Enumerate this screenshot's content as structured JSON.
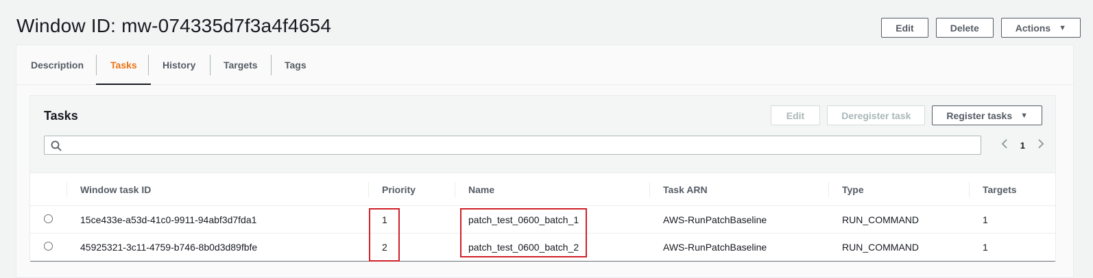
{
  "page": {
    "title": "Window ID: mw-074335d7f3a4f4654",
    "actions": {
      "edit": "Edit",
      "delete": "Delete",
      "actions": "Actions"
    }
  },
  "tabs": [
    "Description",
    "Tasks",
    "History",
    "Targets",
    "Tags"
  ],
  "active_tab": "Tasks",
  "tasks": {
    "title": "Tasks",
    "buttons": {
      "edit": "Edit",
      "deregister": "Deregister task",
      "register": "Register tasks"
    },
    "search": {
      "value": "",
      "placeholder": ""
    },
    "pager": {
      "page": "1"
    },
    "columns": [
      "Window task ID",
      "Priority",
      "Name",
      "Task ARN",
      "Type",
      "Targets"
    ],
    "rows": [
      {
        "id": "15ce433e-a53d-41c0-9911-94abf3d7fda1",
        "priority": "1",
        "name": "patch_test_0600_batch_1",
        "arn": "AWS-RunPatchBaseline",
        "type": "RUN_COMMAND",
        "targets": "1"
      },
      {
        "id": "45925321-3c11-4759-b746-8b0d3d89fbfe",
        "priority": "2",
        "name": "patch_test_0600_batch_2",
        "arn": "AWS-RunPatchBaseline",
        "type": "RUN_COMMAND",
        "targets": "1"
      }
    ]
  },
  "colors": {
    "accent": "#ec7211",
    "highlight": "#d01f26",
    "text": "#16191f",
    "muted": "#545b64",
    "background": "#f2f3f3"
  },
  "icons": [
    "search-icon",
    "caret-down-icon",
    "chevron-left-icon",
    "chevron-right-icon",
    "radio-icon"
  ]
}
